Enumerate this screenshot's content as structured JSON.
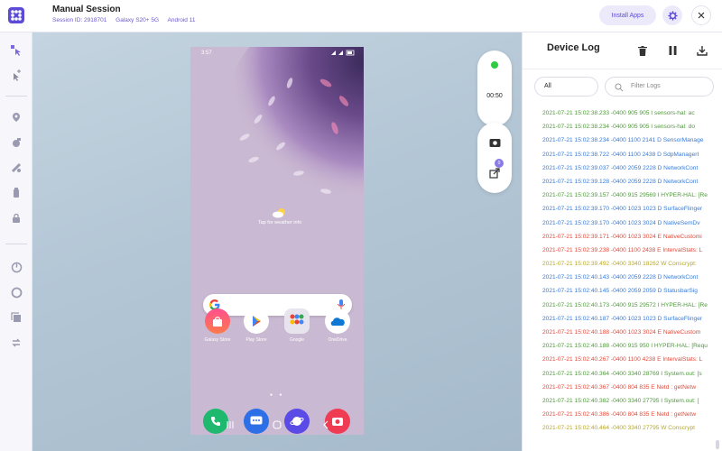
{
  "header": {
    "title": "Manual Session",
    "session_id": "Session ID: 2918701",
    "device": "Galaxy S20+ 5G",
    "os": "Android 11",
    "install_apps": "Install Apps"
  },
  "phone": {
    "time": "3:57",
    "weather_text": "Tap for weather info",
    "apps": [
      {
        "label": "Galaxy Store"
      },
      {
        "label": "Play Store"
      },
      {
        "label": "Google"
      },
      {
        "label": "OneDrive"
      }
    ]
  },
  "controls": {
    "timer": "00:50",
    "badge": "0"
  },
  "device_log": {
    "title": "Device Log",
    "level": "All",
    "filter_placeholder": "Filter Logs",
    "lines": [
      {
        "text": "2021-07-21 15:02:38.233 -0400 905 905 I sensors-hal: ac",
        "color": "#4e9a3a"
      },
      {
        "text": "2021-07-21 15:02:38.234 -0400 905 905 I sensors-hal: do",
        "color": "#4e9a3a"
      },
      {
        "text": "2021-07-21 15:02:38.234 -0400 1100 2141 D SensorManage",
        "color": "#3a7bd5"
      },
      {
        "text": "2021-07-21 15:02:38.722 -0400 1100 2438 D SdpManagerI",
        "color": "#3a7bd5"
      },
      {
        "text": "2021-07-21 15:02:39.037 -0400 2059 2228 D NetworkCont",
        "color": "#3a7bd5"
      },
      {
        "text": "2021-07-21 15:02:39.128 -0400 2059 2228 D NetworkCont",
        "color": "#3a7bd5"
      },
      {
        "text": "2021-07-21 15:02:39.157 -0400 915 29569 I HYPER-HAL: [Re",
        "color": "#4e9a3a"
      },
      {
        "text": "2021-07-21 15:02:39.170 -0400 1023 1023 D SurfaceFlinger",
        "color": "#3a7bd5"
      },
      {
        "text": "2021-07-21 15:02:39.170 -0400 1023 3024 D NativeSemDv",
        "color": "#3a7bd5"
      },
      {
        "text": "2021-07-21 15:02:39.171 -0400 1023 3024 E NativeCustomi",
        "color": "#e04b3c"
      },
      {
        "text": "2021-07-21 15:02:39.238 -0400 1100 2438 E IntervalStats: L",
        "color": "#e04b3c"
      },
      {
        "text": "2021-07-21 15:02:39.492 -0400 3340 18262 W Conscrypt:",
        "color": "#b8a82a"
      },
      {
        "text": "2021-07-21 15:02:40.143 -0400 2059 2228 D NetworkCont",
        "color": "#3a7bd5"
      },
      {
        "text": "2021-07-21 15:02:40.145 -0400 2059 2059 D StatusbarSig",
        "color": "#3a7bd5"
      },
      {
        "text": "2021-07-21 15:02:40.173 -0400 915 29572 I HYPER-HAL: [Re",
        "color": "#4e9a3a"
      },
      {
        "text": "2021-07-21 15:02:40.187 -0400 1023 1023 D SurfaceFlinger",
        "color": "#3a7bd5"
      },
      {
        "text": "2021-07-21 15:02:40.188 -0400 1023 3024 E NativeCustom",
        "color": "#e04b3c"
      },
      {
        "text": "2021-07-21 15:02:40.188 -0400 915 950 I HYPER-HAL: [Requ",
        "color": "#4e9a3a"
      },
      {
        "text": "2021-07-21 15:02:40.267 -0400 1100 4238 E IntervalStats: L",
        "color": "#e04b3c"
      },
      {
        "text": "2021-07-21 15:02:40.364 -0400 3340 28769 I System.out: [s",
        "color": "#4e9a3a"
      },
      {
        "text": "2021-07-21 15:02:40.367 -0400 804 835 E Netd : getNetw",
        "color": "#e04b3c"
      },
      {
        "text": "2021-07-21 15:02:40.382 -0400 3340 27795 I System.out: [",
        "color": "#4e9a3a"
      },
      {
        "text": "2021-07-21 15:02:40.386 -0400 804 835 E Netd : getNetw",
        "color": "#e04b3c"
      },
      {
        "text": "2021-07-21 15:02:40.464 -0400 3340 27795 W Conscrypt",
        "color": "#b8a82a"
      }
    ]
  },
  "colors": {
    "accent": "#6a5acd",
    "accent_soft": "#ece9fb",
    "info": "#4e9a3a",
    "debug": "#3a7bd5",
    "error": "#e04b3c",
    "warn": "#b8a82a"
  },
  "icons": {
    "header": [
      "logo-icon",
      "gear-icon",
      "close-icon"
    ],
    "sidebar": [
      "tap-icon",
      "gesture-icon",
      "location-icon",
      "camera-icon",
      "biometric-icon",
      "device-icon",
      "lock-icon",
      "power-icon",
      "circle-icon",
      "copy-icon",
      "rotate-icon"
    ],
    "log": [
      "trash-icon",
      "pause-icon",
      "download-icon",
      "search-icon"
    ]
  }
}
